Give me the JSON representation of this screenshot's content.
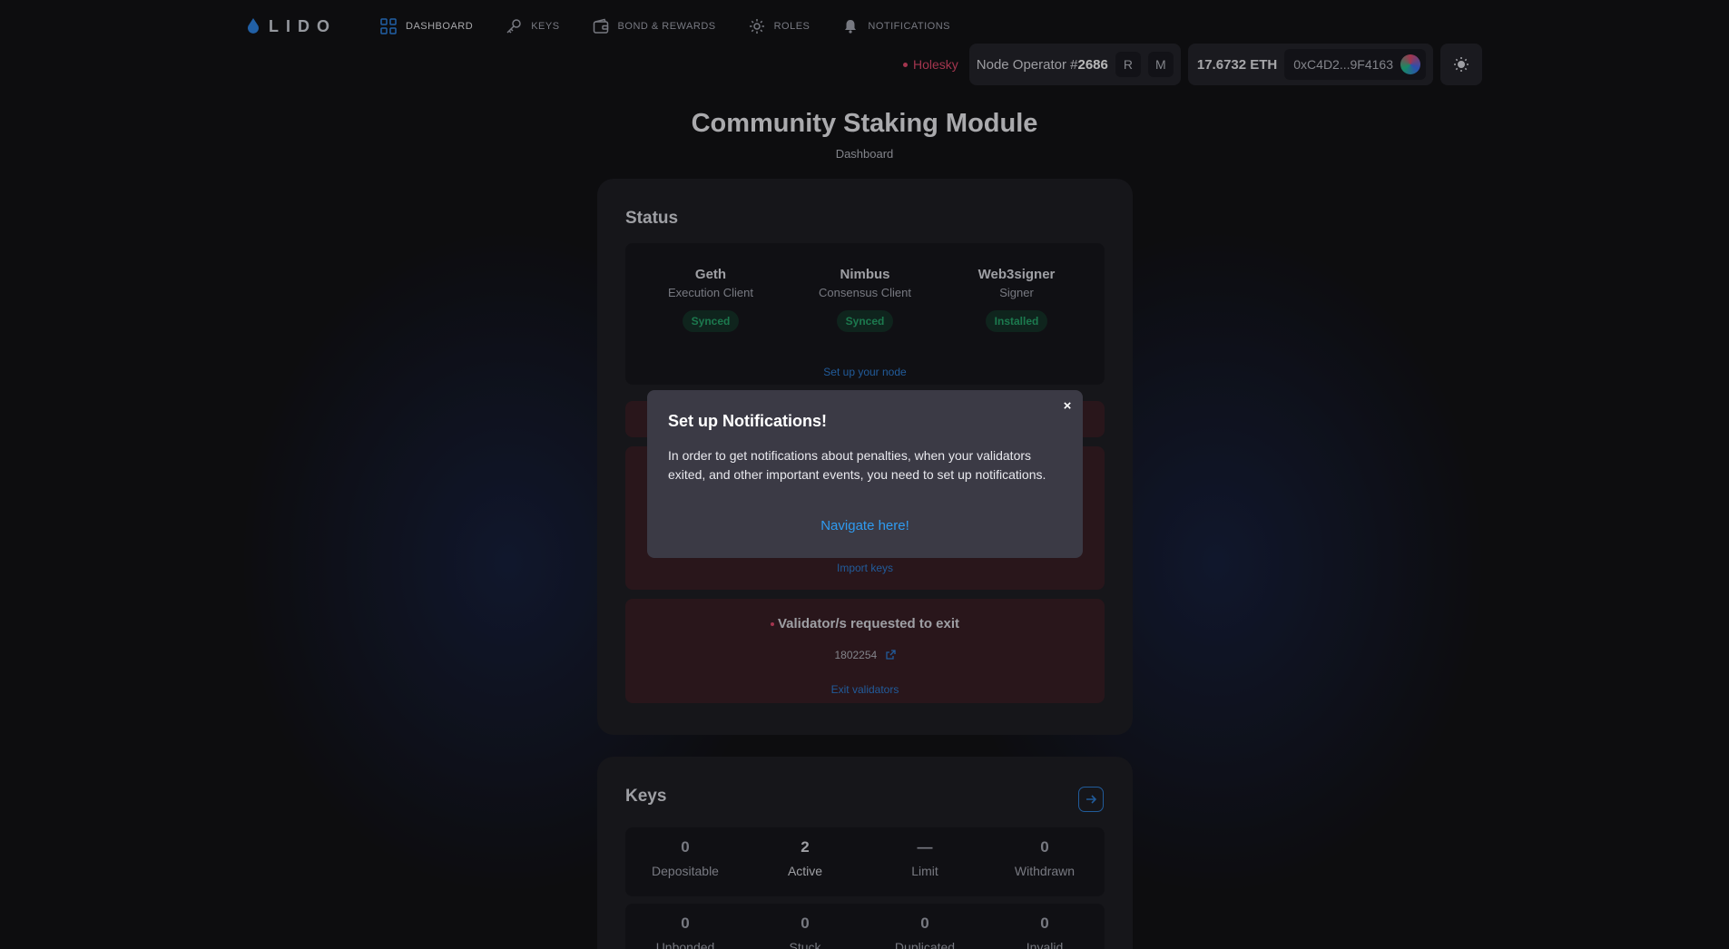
{
  "nav": {
    "logo_text": "LIDO",
    "items": [
      {
        "label": "DASHBOARD",
        "icon": "grid-icon"
      },
      {
        "label": "KEYS",
        "icon": "key-icon"
      },
      {
        "label": "BOND & REWARDS",
        "icon": "wallet-icon"
      },
      {
        "label": "ROLES",
        "icon": "gear-icon"
      },
      {
        "label": "NOTIFICATIONS",
        "icon": "bell-icon"
      }
    ]
  },
  "header": {
    "network": "Holesky",
    "operator_prefix": "Node Operator #",
    "operator_id": "2686",
    "role_r": "R",
    "role_m": "M",
    "balance": "17.6732 ETH",
    "address": "0xC4D2...9F4163"
  },
  "page": {
    "title": "Community Staking Module",
    "subtitle": "Dashboard"
  },
  "status": {
    "title": "Status",
    "clients": [
      {
        "name": "Geth",
        "type": "Execution Client",
        "state": "Synced"
      },
      {
        "name": "Nimbus",
        "type": "Consensus Client",
        "state": "Synced"
      },
      {
        "name": "Web3signer",
        "type": "Signer",
        "state": "Installed"
      }
    ],
    "setup_link": "Set up your node",
    "import_link": "Import keys",
    "exit_title": "Validator/s requested to exit",
    "validator_id": "1802254",
    "exit_link": "Exit validators"
  },
  "keys": {
    "title": "Keys",
    "row1": [
      {
        "value": "0",
        "label": "Depositable"
      },
      {
        "value": "2",
        "label": "Active"
      },
      {
        "value": "—",
        "label": "Limit"
      },
      {
        "value": "0",
        "label": "Withdrawn"
      }
    ],
    "row2": [
      {
        "value": "0",
        "label": "Unbonded"
      },
      {
        "value": "0",
        "label": "Stuck"
      },
      {
        "value": "0",
        "label": "Duplicated"
      },
      {
        "value": "0",
        "label": "Invalid"
      }
    ]
  },
  "modal": {
    "title": "Set up Notifications!",
    "body": "In order to get notifications about penalties, when your validators exited, and other important events, you need to set up notifications.",
    "link": "Navigate here!",
    "close": "×"
  }
}
